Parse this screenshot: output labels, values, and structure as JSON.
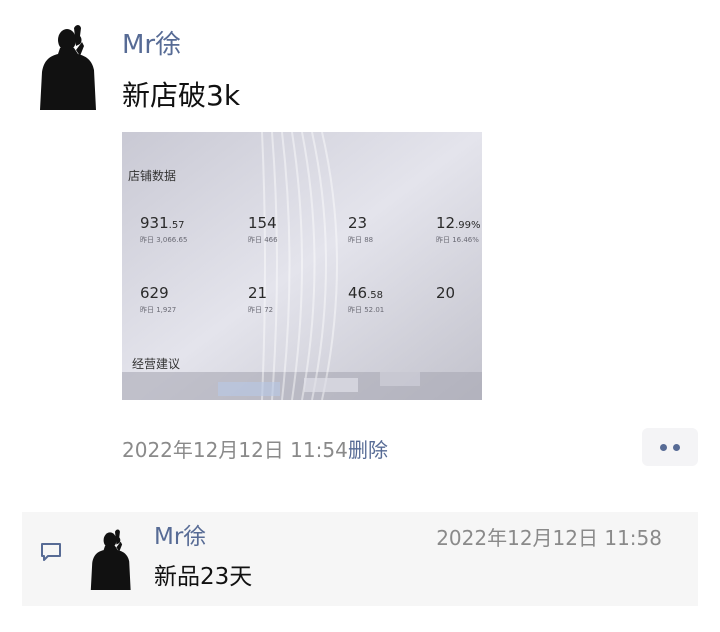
{
  "post": {
    "author": "Mr徐",
    "text": "新店破3k",
    "timestamp": "2022年12月12日 11:54",
    "delete_label": "删除",
    "more_icon": "more-dots-icon"
  },
  "photo": {
    "section_title": "店铺数据",
    "section_title_2": "经营建议",
    "metrics": [
      {
        "value": "931",
        "decimal": ".57",
        "sub": "昨日 3,066.65"
      },
      {
        "value": "154",
        "decimal": "",
        "sub": "昨日 466"
      },
      {
        "value": "23",
        "decimal": "",
        "sub": "昨日 88"
      },
      {
        "value": "12",
        "decimal": ".99%",
        "sub": "昨日 16.46%"
      },
      {
        "value": "629",
        "decimal": "",
        "sub": "昨日 1,927"
      },
      {
        "value": "21",
        "decimal": "",
        "sub": "昨日 72"
      },
      {
        "value": "46",
        "decimal": ".58",
        "sub": "昨日 52.01"
      },
      {
        "value": "20",
        "decimal": "",
        "sub": ""
      }
    ]
  },
  "comment": {
    "author": "Mr徐",
    "time": "2022年12月12日 11:58",
    "text": "新品23天",
    "icon": "comment-icon"
  },
  "colors": {
    "link_blue": "#576b95",
    "meta_gray": "#8a8a8a",
    "comment_bg": "#f6f6f6"
  }
}
